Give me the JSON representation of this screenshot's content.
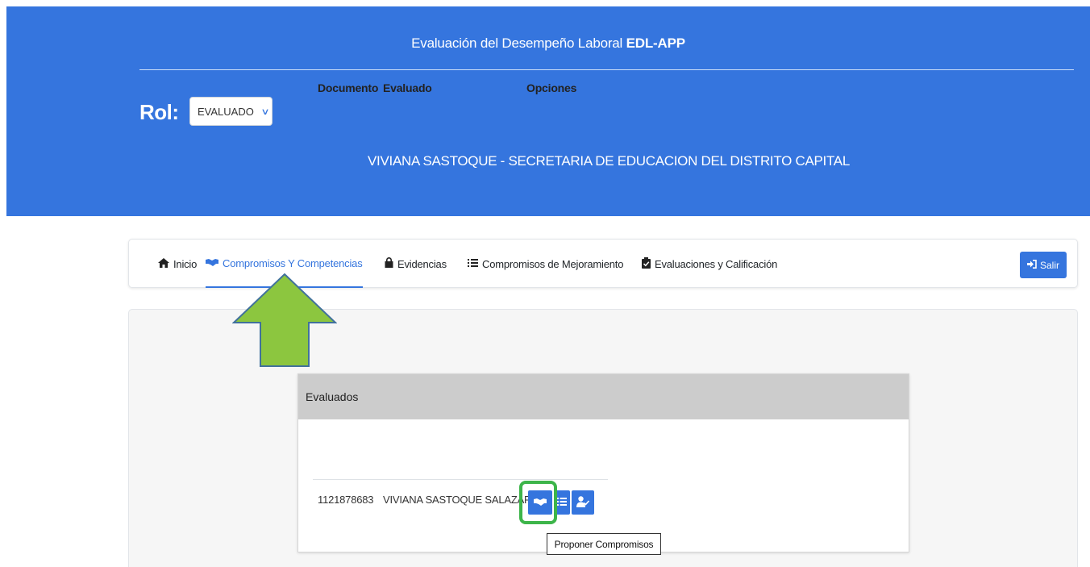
{
  "header": {
    "title_prefix": "Evaluación del Desempeño Laboral",
    "title_bold": "EDL-APP",
    "rol_label": "Rol:",
    "rol_selected": "EVALUADO",
    "user_line": "VIVIANA SASTOQUE - SECRETARIA DE EDUCACION DEL DISTRITO CAPITAL"
  },
  "nav": {
    "items": [
      {
        "label": "Inicio",
        "icon": "home-icon"
      },
      {
        "label": "Compromisos Y Competencias",
        "icon": "handshake-icon",
        "active": true
      },
      {
        "label": "Evidencias",
        "icon": "lock-icon"
      },
      {
        "label": "Compromisos de Mejoramiento",
        "icon": "list-icon"
      },
      {
        "label": "Evaluaciones y Calificación",
        "icon": "clipboard-check-icon"
      }
    ],
    "logout_label": "Salir"
  },
  "card": {
    "title": "Evaluados",
    "columns": [
      "Documento",
      "Evaluado",
      "Opciones"
    ],
    "rows": [
      {
        "documento": "1121878683",
        "evaluado": "VIVIANA SASTOQUE SALAZAR"
      }
    ],
    "options": [
      "handshake-icon",
      "list-icon",
      "user-check-icon"
    ],
    "tooltip": "Proponer Compromisos"
  },
  "colors": {
    "primary": "#3575de",
    "highlight": "#3db54a",
    "arrow_fill": "#8cc63f",
    "arrow_stroke": "#41719c"
  }
}
